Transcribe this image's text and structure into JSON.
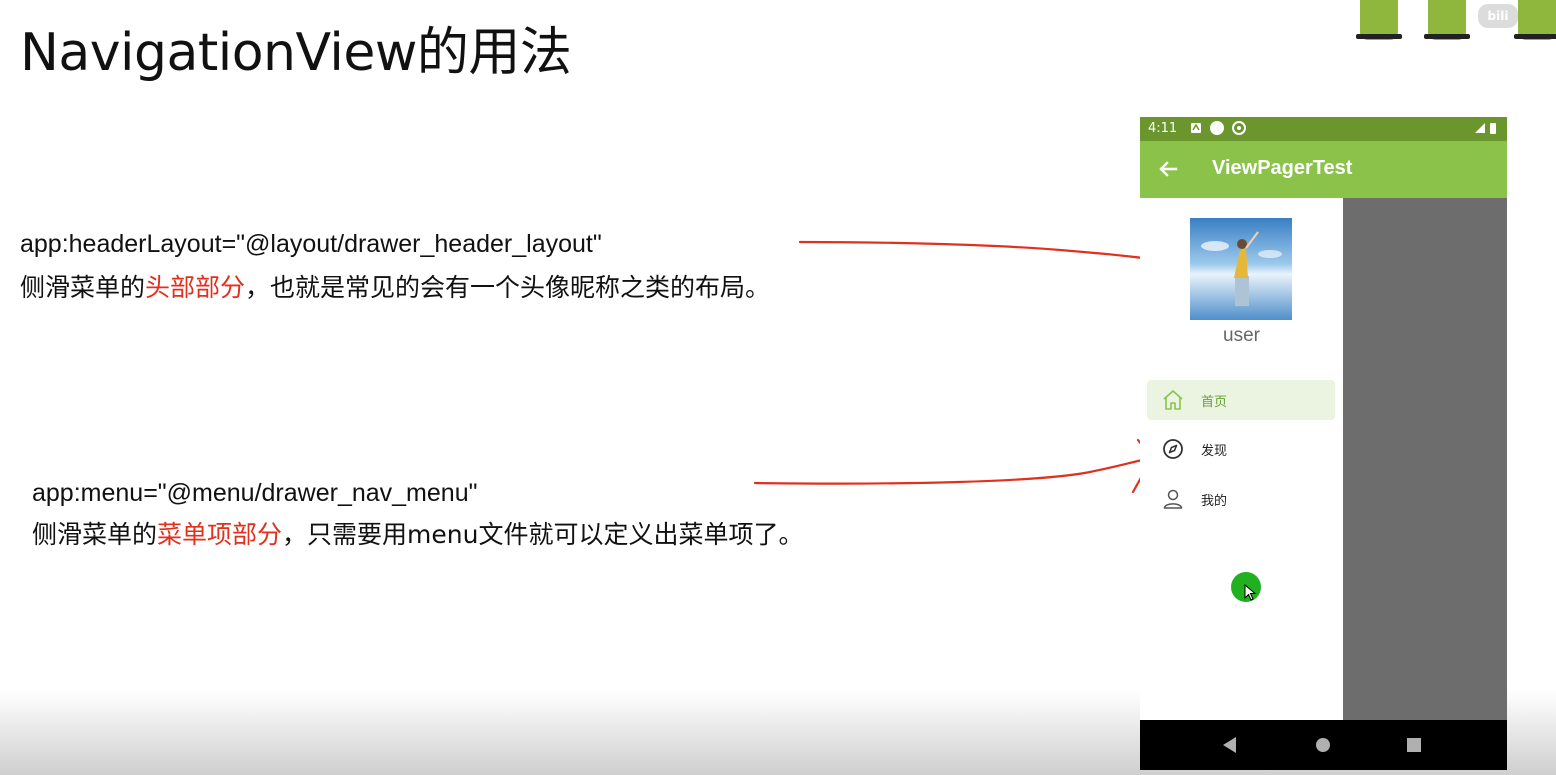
{
  "slide": {
    "title": "NavigationView的用法",
    "header_note": {
      "code": "app:headerLayout=\"@layout/drawer_header_layout\"",
      "desc_prefix": "侧滑菜单的",
      "desc_highlight": "头部部分",
      "desc_suffix": "，也就是常见的会有一个头像昵称之类的布局。"
    },
    "menu_note": {
      "code": "app:menu=\"@menu/drawer_nav_menu\"",
      "desc_prefix": "侧滑菜单的",
      "desc_highlight": "菜单项部分",
      "desc_suffix": "，只需要用menu文件就可以定义出菜单项了。"
    },
    "highlight_color": "#e0301e",
    "annotation_color": "#e0301e"
  },
  "phone": {
    "status_bar": {
      "time": "4:11",
      "color": "#6b962e"
    },
    "app_bar": {
      "title": "ViewPagerTest",
      "color": "#8bc34a",
      "back_icon": "arrow-back-icon"
    },
    "drawer": {
      "header": {
        "user_name": "user"
      },
      "menu": [
        {
          "label": "首页",
          "icon": "home-icon",
          "selected": true
        },
        {
          "label": "发现",
          "icon": "compass-icon",
          "selected": false
        },
        {
          "label": "我的",
          "icon": "person-icon",
          "selected": false
        }
      ]
    },
    "nav_bar": {
      "buttons": [
        "back-triangle-icon",
        "home-circle-icon",
        "recents-square-icon"
      ]
    }
  }
}
